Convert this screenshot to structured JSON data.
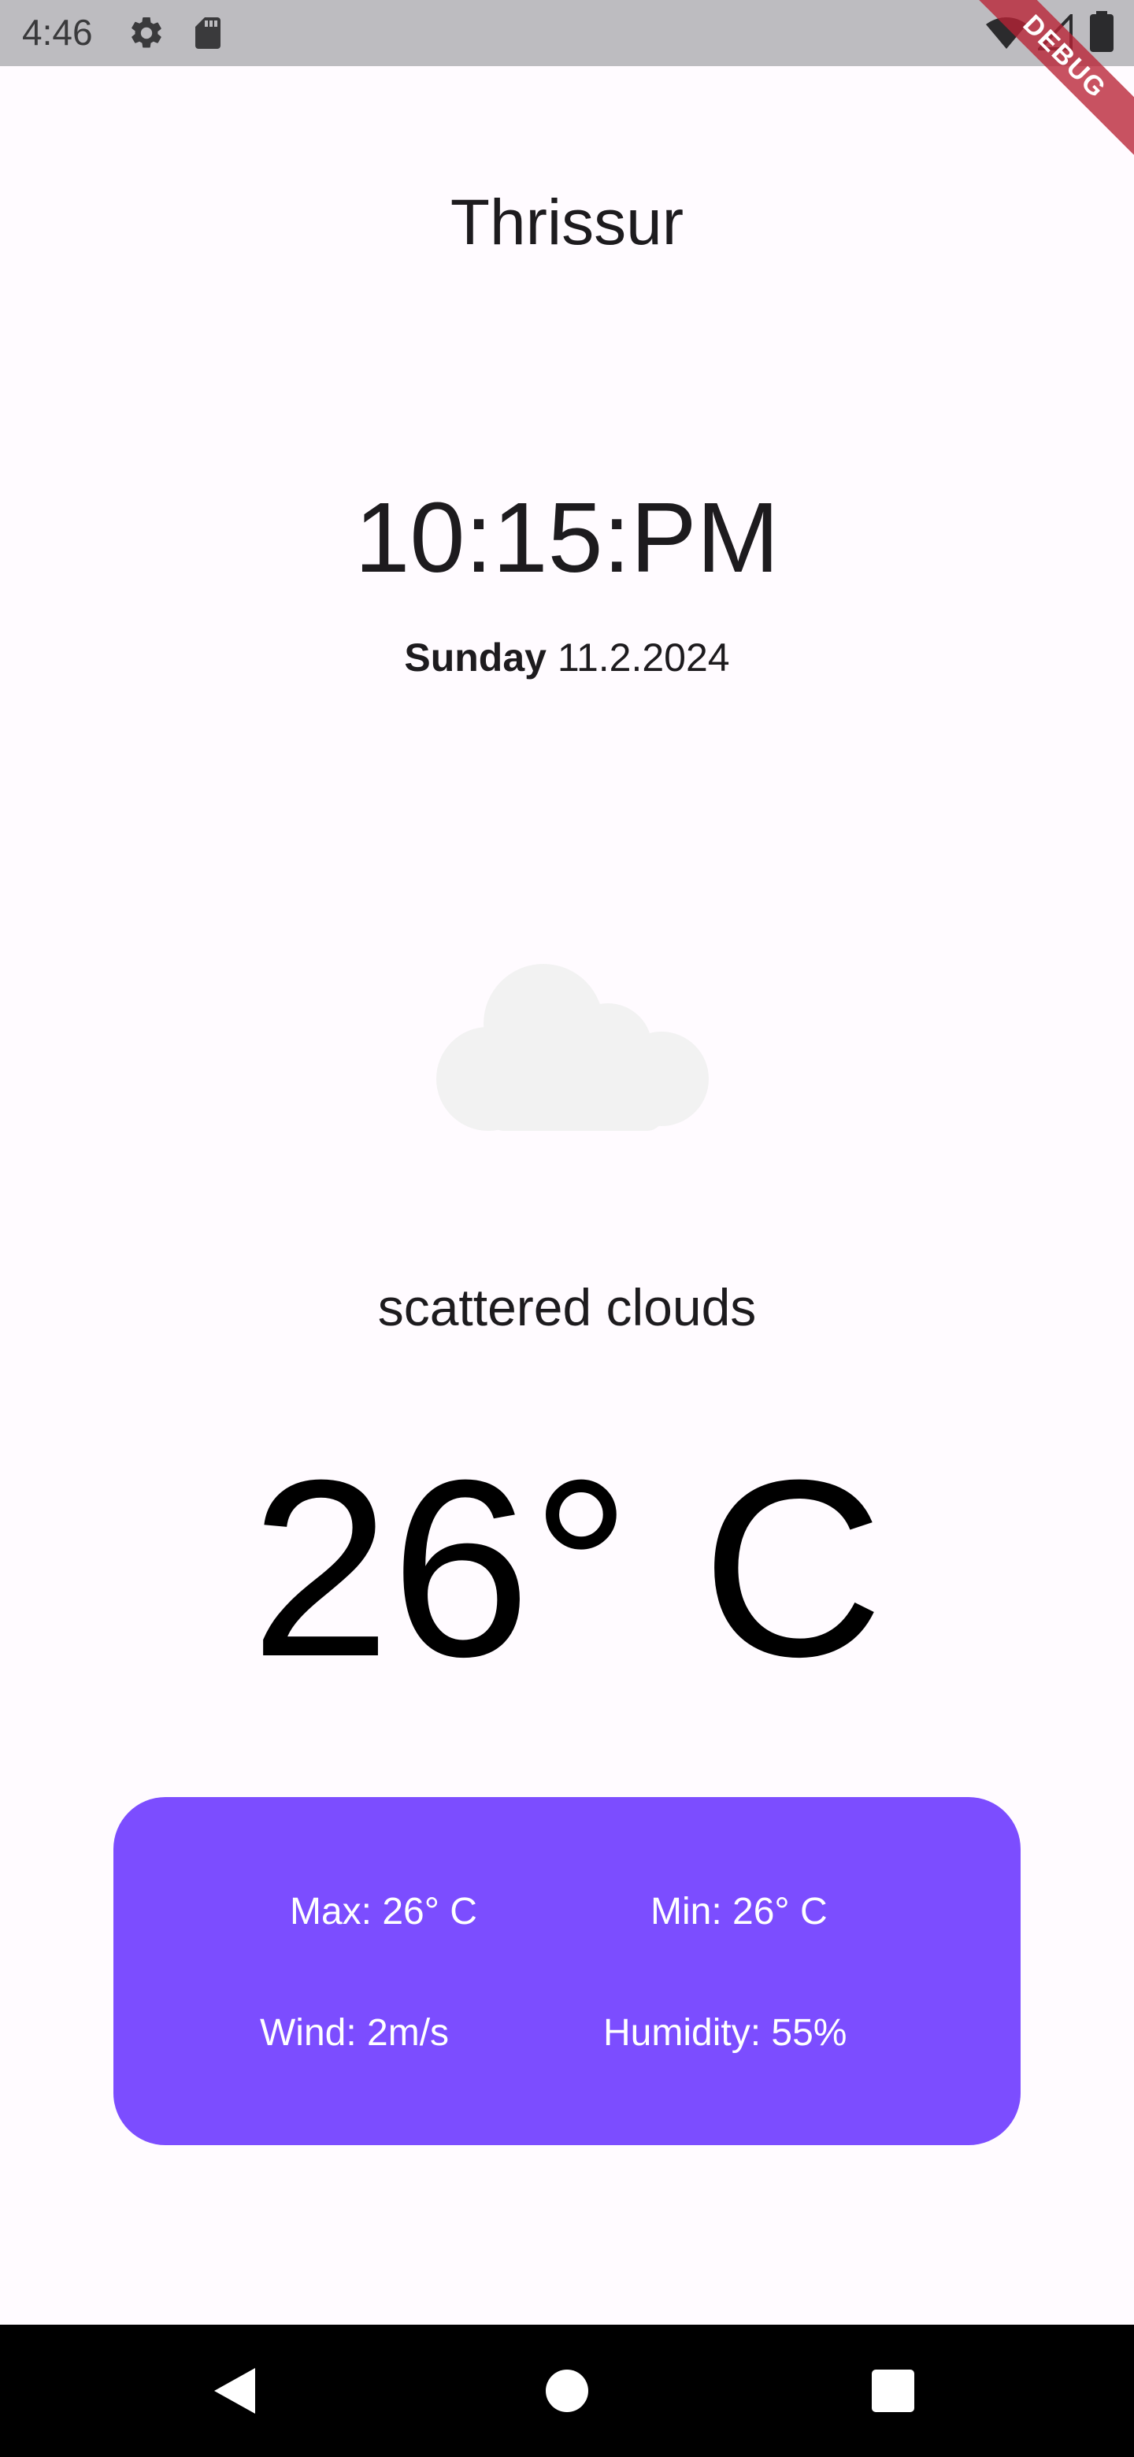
{
  "status_bar": {
    "time": "4:46",
    "icons": [
      "gear-icon",
      "sd-card-icon",
      "wifi-icon",
      "signal-icon",
      "battery-icon"
    ]
  },
  "debug_banner": {
    "label": "DEBUG",
    "color": "#b82234"
  },
  "weather": {
    "city": "Thrissur",
    "time": "10:15:PM",
    "day": "Sunday",
    "date": "11.2.2024",
    "icon": "cloud-icon",
    "description": "scattered clouds",
    "temperature": "26° C"
  },
  "details": {
    "max": "Max: 26° C",
    "min": "Min: 26° C",
    "wind": "Wind: 2m/s",
    "humidity": "Humidity: 55%",
    "card_color": "#7c4dff"
  },
  "nav_bar": {
    "buttons": [
      "back-icon",
      "home-icon",
      "recents-icon"
    ]
  }
}
